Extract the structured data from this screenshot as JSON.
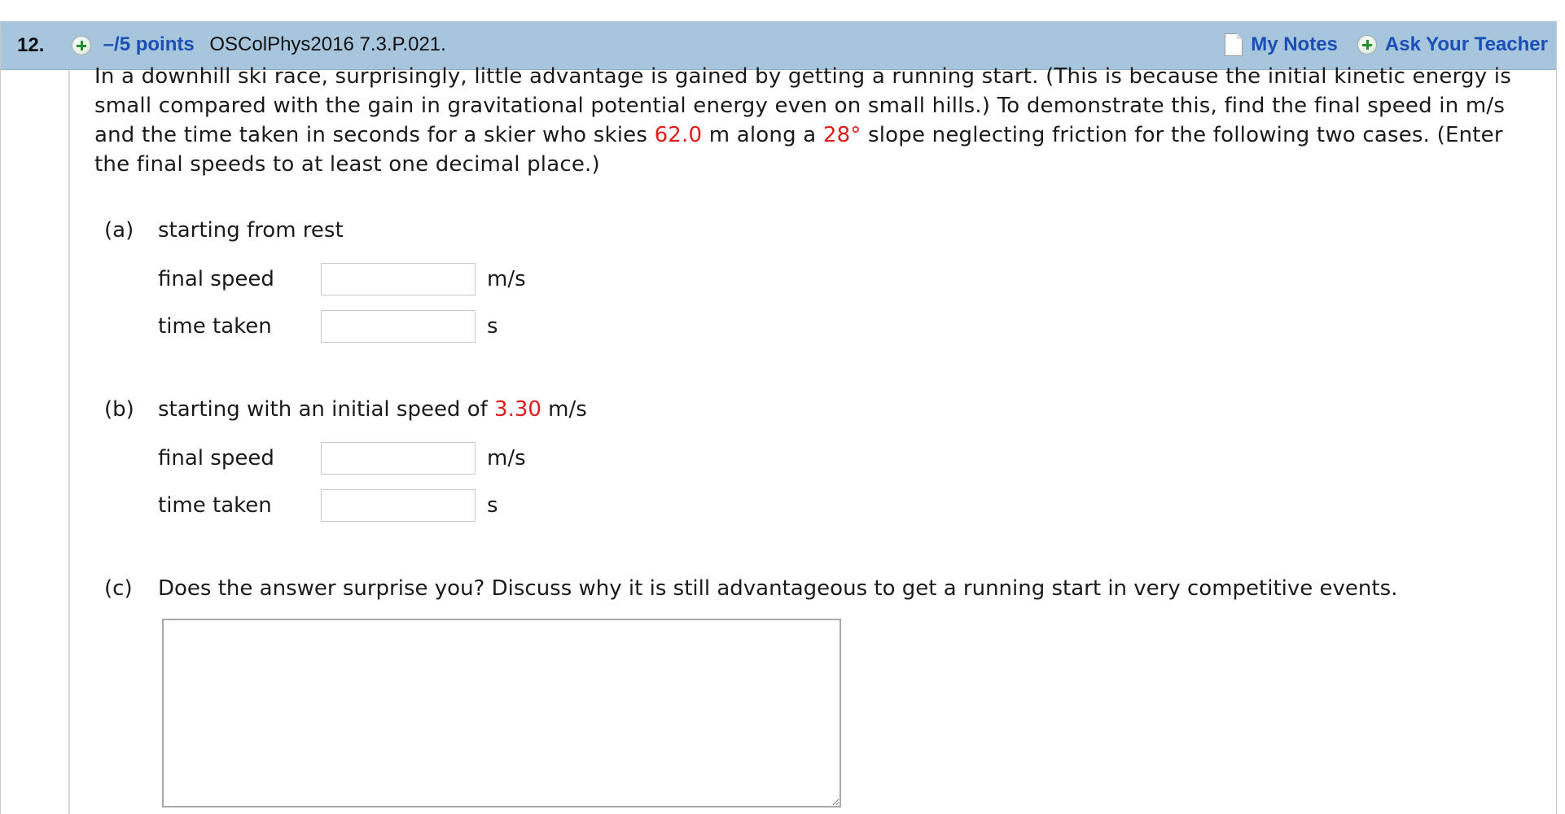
{
  "header": {
    "question_number": "12.",
    "points_label": "–/5 points",
    "reference_code": "OSColPhys2016 7.3.P.021.",
    "my_notes_label": "My Notes",
    "ask_teacher_label": "Ask Your Teacher"
  },
  "problem": {
    "text_1": "In a downhill ski race, surprisingly, little advantage is gained by getting a running start. (This is because the initial kinetic energy is small compared with the gain in gravitational potential energy even on small hills.) To demonstrate this, find the final speed in m/s and the time taken in seconds for a skier who skies ",
    "distance_value": "62.0",
    "text_2": " m along a ",
    "angle_value": "28°",
    "text_3": " slope neglecting friction for the following two cases. (Enter the final speeds to at least one decimal place.)"
  },
  "parts": {
    "a": {
      "letter": "(a)",
      "prompt": "starting from rest",
      "final_speed_label": "final speed",
      "final_speed_value": "",
      "final_speed_unit": "m/s",
      "time_label": "time taken",
      "time_value": "",
      "time_unit": "s"
    },
    "b": {
      "letter": "(b)",
      "prompt_1": "starting with an initial speed of ",
      "initial_speed_value": "3.30",
      "prompt_2": " m/s",
      "final_speed_label": "final speed",
      "final_speed_value": "",
      "final_speed_unit": "m/s",
      "time_label": "time taken",
      "time_value": "",
      "time_unit": "s"
    },
    "c": {
      "letter": "(c)",
      "prompt": "Does the answer surprise you? Discuss why it is still advantageous to get a running start in very competitive events.",
      "answer_value": ""
    }
  },
  "colors": {
    "header_bg": "#a7c5dd",
    "link": "#1a4fb5",
    "highlight_value": "#e01b1b",
    "plus_icon": "#1f8f2a"
  },
  "icons": {
    "expand": "plus-circle-icon",
    "notes": "document-icon",
    "ask": "plus-circle-icon"
  }
}
